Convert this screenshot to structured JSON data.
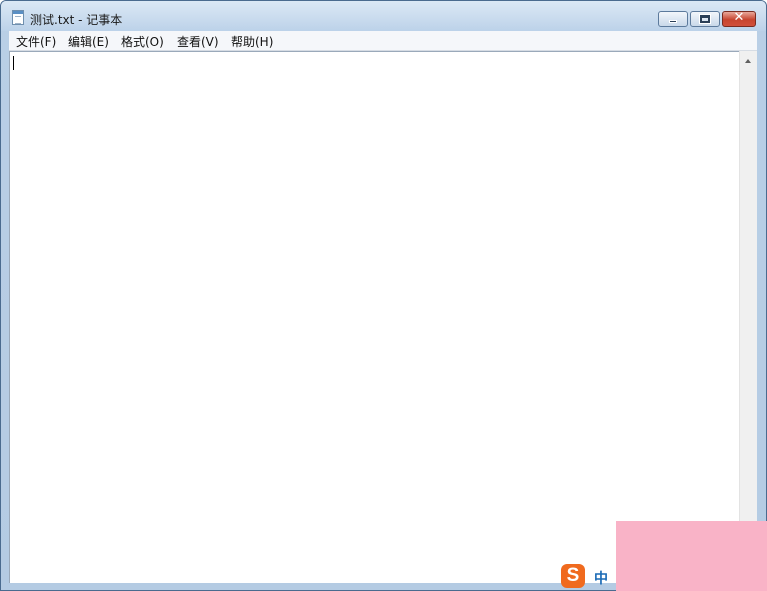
{
  "window": {
    "title": "测试.txt - 记事本"
  },
  "menu": {
    "file": "文件(F)",
    "edit": "编辑(E)",
    "format": "格式(O)",
    "view": "查看(V)",
    "help": "帮助(H)"
  },
  "editor": {
    "content": ""
  },
  "ime": {
    "logo": "S",
    "mode": "中"
  },
  "icons": {
    "app": "notepad-icon",
    "minimize": "minimize-icon",
    "maximize": "maximize-icon",
    "close": "close-icon",
    "scroll_up": "arrow-up-icon",
    "ime": "sogou-ime-icon"
  },
  "colors": {
    "close_button": "#c7442f",
    "ime_logo": "#f06a1e",
    "ime_mode": "#1a6ab5",
    "overlay": "#f9b3c7"
  }
}
